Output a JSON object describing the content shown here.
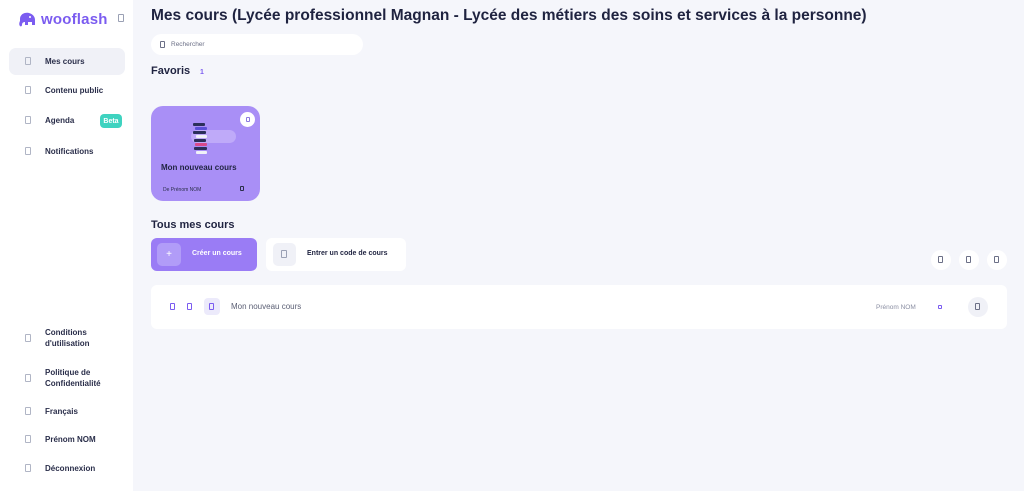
{
  "brand": {
    "name": "wooflash",
    "logo_icon": "elephant-icon",
    "accent": "#7b5cf0"
  },
  "sidebar": {
    "items": [
      {
        "label": "Mes cours",
        "icon": "book-icon",
        "active": true
      },
      {
        "label": "Contenu public",
        "icon": "globe-icon"
      },
      {
        "label": "Agenda",
        "icon": "calendar-icon",
        "badge": "Beta"
      },
      {
        "label": "Notifications",
        "icon": "bell-icon"
      }
    ],
    "footer": [
      {
        "label": "Conditions d'utilisation",
        "icon": "document-icon"
      },
      {
        "label": "Politique de Confidentialité",
        "icon": "lock-icon"
      },
      {
        "label": "Français",
        "icon": "language-icon"
      },
      {
        "label": "Prénom NOM",
        "icon": "user-icon"
      },
      {
        "label": "Déconnexion",
        "icon": "logout-icon"
      }
    ]
  },
  "main": {
    "title": "Mes cours (Lycée professionnel Magnan - Lycée des métiers des soins et services à la personne)",
    "search": {
      "placeholder": "Rechercher"
    },
    "favorites": {
      "title": "Favoris",
      "count": "1",
      "cards": [
        {
          "name": "Mon nouveau cours",
          "author": "De Prénom NOM",
          "color": "#a98ff6"
        }
      ]
    },
    "all_courses": {
      "title": "Tous mes cours",
      "create_label": "Créer un cours",
      "create_icon": "+",
      "code_label": "Entrer un code de cours",
      "rows": [
        {
          "name": "Mon nouveau cours",
          "author": "Prénom NOM"
        }
      ]
    }
  }
}
